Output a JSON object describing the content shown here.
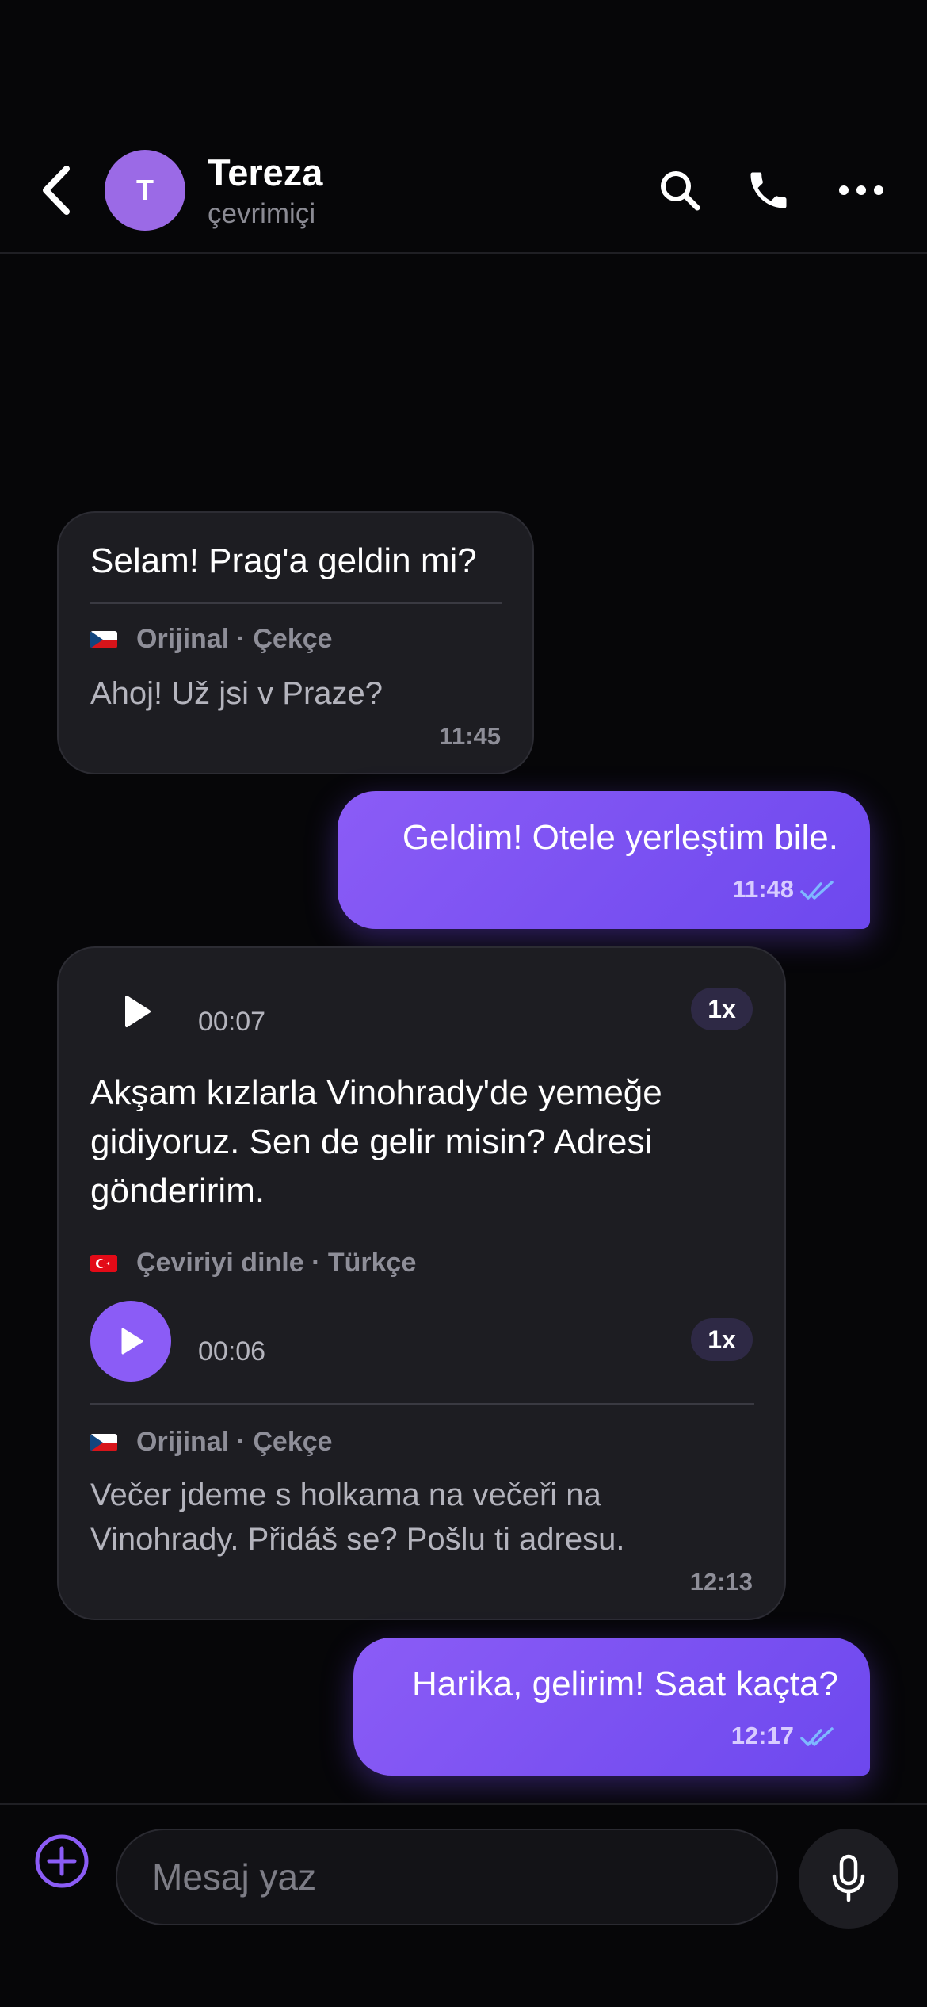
{
  "header": {
    "avatar_initial": "T",
    "contact_name": "Tereza",
    "status": "çevrimiçi",
    "icons": [
      "chevron-left-icon",
      "search-icon",
      "phone-icon",
      "more-icon"
    ]
  },
  "messages": [
    {
      "direction": "incoming",
      "translated": "Selam! Prag'a geldin mi?",
      "original_label": "Orijinal · Çekçe",
      "original": "Ahoj! Už jsi v Praze?",
      "time": "11:45"
    },
    {
      "direction": "outgoing",
      "text": "Geldim! Otele yerleştim bile.",
      "time": "11:48",
      "status": "read"
    },
    {
      "direction": "incoming",
      "type": "voice",
      "voice_duration": "00:07",
      "voice_speed": "1x",
      "translated": "Akşam kızlarla Vinohrady'de yemeğe gidiyoruz. Sen de gelir misin? Adresi gönderirim.",
      "translation_label": "Çeviriyi dinle · Türkçe",
      "translation_duration": "00:06",
      "translation_speed": "1x",
      "original_label": "Orijinal · Çekçe",
      "original": "Večer jdeme s holkama na večeři na Vinohrady. Přidáš se? Pošlu ti adresu.",
      "time": "12:13"
    },
    {
      "direction": "outgoing",
      "text": "Harika, gelirim! Saat kaçta?",
      "time": "12:17",
      "status": "read"
    }
  ],
  "composer": {
    "placeholder": "Mesaj yaz"
  },
  "colors": {
    "background": "#060608",
    "accent": "#8b5cf6",
    "incoming_bubble": "#1d1d22",
    "read_ticks": "#7fb8ff"
  }
}
